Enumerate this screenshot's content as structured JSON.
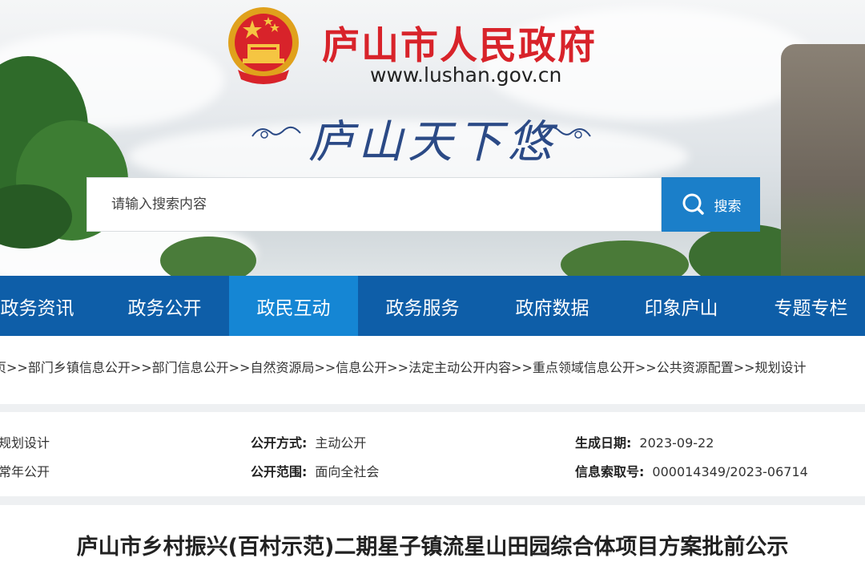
{
  "header": {
    "site_title": "庐山市人民政府",
    "site_url": "www.lushan.gov.cn",
    "slogan": "庐山天下悠"
  },
  "search": {
    "placeholder": "请输入搜索内容",
    "button_label": "搜索"
  },
  "nav": {
    "items": [
      "政务资讯",
      "政务公开",
      "政民互动",
      "政务服务",
      "政府数据",
      "印象庐山",
      "专题专栏"
    ],
    "active_index": 2
  },
  "breadcrumb": {
    "text": "页>>部门乡镇信息公开>>部门信息公开>>自然资源局>>信息公开>>法定主动公开内容>>重点领域信息公开>>公共资源配置>>规划设计"
  },
  "meta": {
    "category_value": "规划设计",
    "period_value": "常年公开",
    "disclosure_method_label": "公开方式:",
    "disclosure_method_value": "主动公开",
    "disclosure_scope_label": "公开范围:",
    "disclosure_scope_value": "面向全社会",
    "generated_date_label": "生成日期:",
    "generated_date_value": "2023-09-22",
    "index_number_label": "信息索取号:",
    "index_number_value": "000014349/2023-06714"
  },
  "article": {
    "title": "庐山市乡村振兴(百村示范)二期星子镇流星山田园综合体项目方案批前公示"
  },
  "colors": {
    "brand_red": "#d8232a",
    "nav_blue": "#0e5ea8",
    "nav_active": "#1586d4",
    "search_blue": "#1b7fc9"
  }
}
